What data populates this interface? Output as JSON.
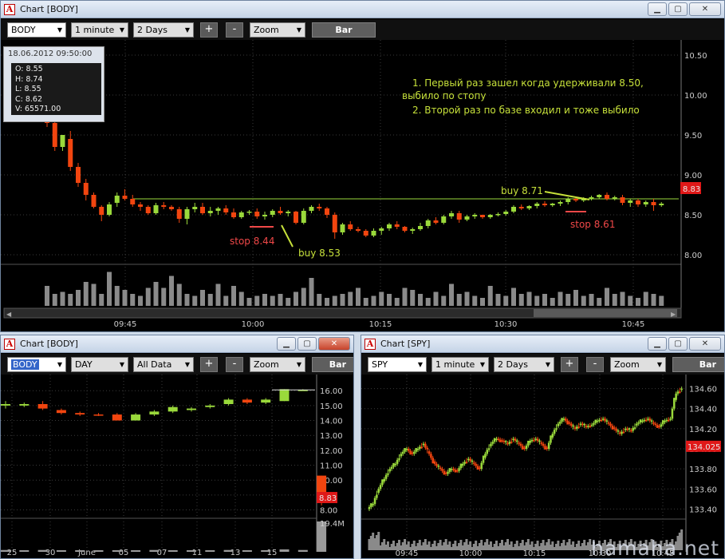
{
  "colors": {
    "up": "#9ad93b",
    "down": "#f2450f",
    "grid": "#2e2e2e",
    "note": "#c6e03a",
    "stop": "#f04848",
    "badge": "#e01818"
  },
  "main": {
    "title": "Chart [BODY]",
    "toolbar": {
      "symbol": "BODY",
      "interval": "1 minute",
      "range": "2 Days",
      "zoom": "Zoom",
      "plus": "+",
      "minus": "-",
      "bar": "Bar"
    },
    "info": {
      "datetime": "18.06.2012 09:50:00",
      "o": "O: 8.55",
      "h": "H: 8.74",
      "l": "L: 8.55",
      "c": "C: 8.62",
      "v": "V: 65571.00"
    },
    "notes": {
      "line1": "1. Первый раз зашел когда удерживали 8.50,",
      "line2": "выбило по стопу",
      "line3": "2. Второй раз по базе входил и тоже выбило"
    },
    "annotations": {
      "buy1": "buy 8.53",
      "buy2": "buy 8.71",
      "stop1": "stop 8.44",
      "stop2": "stop 8.61"
    },
    "current_price": "8.83",
    "price_ticks": [
      "10.50",
      "10.00",
      "9.50",
      "9.00",
      "8.50",
      "8.00"
    ],
    "time_ticks": [
      "09:45",
      "10:00",
      "10:15",
      "10:30",
      "10:45"
    ]
  },
  "daily": {
    "title": "Chart [BODY]",
    "toolbar": {
      "symbol": "BODY",
      "interval": "DAY",
      "range": "All Data",
      "zoom": "Zoom",
      "plus": "+",
      "minus": "-",
      "bar": "Bar"
    },
    "current_price": "8.83",
    "volume_label": "19.4M",
    "price_ticks": [
      "16.00",
      "15.00",
      "14.00",
      "13.00",
      "12.00",
      "11.00",
      "10.00",
      "9.00",
      "8.00"
    ],
    "date_ticks": [
      "25",
      "30",
      "June",
      "05",
      "07",
      "11",
      "13",
      "15"
    ]
  },
  "spy": {
    "title": "Chart [SPY]",
    "toolbar": {
      "symbol": "SPY",
      "interval": "1 minute",
      "range": "2 Days",
      "zoom": "Zoom",
      "plus": "+",
      "minus": "-",
      "bar": "Bar"
    },
    "current_price": "134.025",
    "price_ticks": [
      "134.60",
      "134.40",
      "134.20",
      "134.00",
      "133.80",
      "133.60",
      "133.40"
    ],
    "time_ticks": [
      "09:45",
      "10:00",
      "10:15",
      "10:30",
      "10:45"
    ]
  },
  "watermark": "hamaha.net",
  "chart_data": [
    {
      "type": "candlestick",
      "title": "BODY 1 minute",
      "ylim": [
        7.9,
        10.6
      ],
      "ohlc": [
        [
          9.95,
          10.05,
          9.6,
          9.65
        ],
        [
          9.65,
          9.7,
          9.3,
          9.35
        ],
        [
          9.35,
          9.5,
          9.3,
          9.5
        ],
        [
          9.45,
          9.55,
          9.05,
          9.1
        ],
        [
          9.1,
          9.15,
          8.85,
          8.9
        ],
        [
          8.9,
          8.95,
          8.68,
          8.75
        ],
        [
          8.75,
          8.78,
          8.58,
          8.6
        ],
        [
          8.6,
          8.62,
          8.42,
          8.5
        ],
        [
          8.5,
          8.66,
          8.48,
          8.63
        ],
        [
          8.65,
          8.78,
          8.6,
          8.74
        ],
        [
          8.74,
          8.82,
          8.68,
          8.7
        ],
        [
          8.7,
          8.75,
          8.6,
          8.63
        ],
        [
          8.63,
          8.66,
          8.55,
          8.6
        ],
        [
          8.6,
          8.62,
          8.5,
          8.52
        ],
        [
          8.52,
          8.65,
          8.5,
          8.62
        ],
        [
          8.62,
          8.66,
          8.57,
          8.6
        ],
        [
          8.6,
          8.62,
          8.55,
          8.57
        ],
        [
          8.57,
          8.6,
          8.4,
          8.45
        ],
        [
          8.45,
          8.6,
          8.38,
          8.57
        ],
        [
          8.57,
          8.65,
          8.53,
          8.6
        ],
        [
          8.6,
          8.65,
          8.5,
          8.52
        ],
        [
          8.52,
          8.6,
          8.48,
          8.55
        ],
        [
          8.55,
          8.6,
          8.5,
          8.58
        ],
        [
          8.58,
          8.62,
          8.5,
          8.53
        ],
        [
          8.53,
          8.58,
          8.45,
          8.47
        ],
        [
          8.47,
          8.55,
          8.45,
          8.53
        ],
        [
          8.53,
          8.56,
          8.5,
          8.54
        ],
        [
          8.54,
          8.58,
          8.45,
          8.48
        ],
        [
          8.48,
          8.54,
          8.44,
          8.5
        ],
        [
          8.5,
          8.57,
          8.47,
          8.55
        ],
        [
          8.55,
          8.6,
          8.5,
          8.52
        ],
        [
          8.52,
          8.56,
          8.48,
          8.54
        ],
        [
          8.54,
          8.55,
          8.38,
          8.4
        ],
        [
          8.4,
          8.58,
          8.38,
          8.55
        ],
        [
          8.55,
          8.62,
          8.52,
          8.6
        ],
        [
          8.6,
          8.64,
          8.55,
          8.58
        ],
        [
          8.58,
          8.6,
          8.46,
          8.5
        ],
        [
          8.5,
          8.53,
          8.2,
          8.28
        ],
        [
          8.28,
          8.4,
          8.25,
          8.38
        ],
        [
          8.38,
          8.42,
          8.3,
          8.32
        ],
        [
          8.32,
          8.35,
          8.28,
          8.3
        ],
        [
          8.3,
          8.32,
          8.22,
          8.24
        ],
        [
          8.24,
          8.33,
          8.22,
          8.3
        ],
        [
          8.3,
          8.35,
          8.25,
          8.33
        ],
        [
          8.33,
          8.4,
          8.3,
          8.38
        ],
        [
          8.38,
          8.42,
          8.32,
          8.35
        ],
        [
          8.35,
          8.36,
          8.28,
          8.3
        ],
        [
          8.3,
          8.34,
          8.26,
          8.32
        ],
        [
          8.32,
          8.4,
          8.3,
          8.36
        ],
        [
          8.36,
          8.45,
          8.33,
          8.43
        ],
        [
          8.43,
          8.47,
          8.38,
          8.4
        ],
        [
          8.4,
          8.5,
          8.38,
          8.48
        ],
        [
          8.48,
          8.55,
          8.45,
          8.52
        ],
        [
          8.52,
          8.55,
          8.4,
          8.44
        ],
        [
          8.44,
          8.5,
          8.42,
          8.48
        ],
        [
          8.48,
          8.52,
          8.45,
          8.5
        ],
        [
          8.5,
          8.5,
          8.45,
          8.47
        ],
        [
          8.47,
          8.51,
          8.45,
          8.5
        ],
        [
          8.5,
          8.53,
          8.48,
          8.51
        ],
        [
          8.51,
          8.56,
          8.49,
          8.54
        ],
        [
          8.54,
          8.62,
          8.52,
          8.6
        ],
        [
          8.6,
          8.63,
          8.56,
          8.58
        ],
        [
          8.58,
          8.62,
          8.56,
          8.61
        ],
        [
          8.61,
          8.66,
          8.58,
          8.64
        ],
        [
          8.64,
          8.67,
          8.6,
          8.62
        ],
        [
          8.62,
          8.65,
          8.6,
          8.64
        ],
        [
          8.64,
          8.68,
          8.61,
          8.66
        ],
        [
          8.66,
          8.72,
          8.63,
          8.7
        ],
        [
          8.7,
          8.73,
          8.66,
          8.68
        ],
        [
          8.68,
          8.72,
          8.66,
          8.71
        ],
        [
          8.71,
          8.74,
          8.68,
          8.72
        ],
        [
          8.72,
          8.76,
          8.7,
          8.75
        ],
        [
          8.75,
          8.78,
          8.68,
          8.7
        ],
        [
          8.7,
          8.74,
          8.68,
          8.72
        ],
        [
          8.72,
          8.75,
          8.62,
          8.65
        ],
        [
          8.65,
          8.7,
          8.6,
          8.68
        ],
        [
          8.68,
          8.7,
          8.6,
          8.63
        ],
        [
          8.63,
          8.68,
          8.6,
          8.66
        ],
        [
          8.66,
          8.7,
          8.55,
          8.62
        ],
        [
          8.62,
          8.66,
          8.6,
          8.64
        ]
      ],
      "volume_relative": [
        0.5,
        0.3,
        0.35,
        0.3,
        0.4,
        0.6,
        0.55,
        0.3,
        0.85,
        0.5,
        0.4,
        0.3,
        0.25,
        0.45,
        0.6,
        0.45,
        0.75,
        0.55,
        0.3,
        0.25,
        0.4,
        0.3,
        0.55,
        0.25,
        0.5,
        0.35,
        0.2,
        0.25,
        0.3,
        0.25,
        0.3,
        0.2,
        0.35,
        0.45,
        0.7,
        0.3,
        0.2,
        0.25,
        0.3,
        0.35,
        0.45,
        0.2,
        0.25,
        0.35,
        0.3,
        0.2,
        0.45,
        0.4,
        0.3,
        0.2,
        0.35,
        0.25,
        0.55,
        0.3,
        0.35,
        0.25,
        0.2,
        0.5,
        0.3,
        0.25,
        0.45,
        0.3,
        0.35,
        0.25,
        0.3,
        0.2,
        0.35,
        0.3,
        0.4,
        0.25,
        0.3,
        0.2,
        0.45,
        0.3,
        0.35,
        0.25,
        0.2,
        0.35,
        0.3,
        0.25
      ]
    },
    {
      "type": "candlestick",
      "title": "BODY DAY",
      "ylim": [
        7.6,
        16.6
      ],
      "ohlc": [
        [
          15.0,
          15.3,
          14.8,
          15.1
        ],
        [
          15.0,
          15.2,
          14.9,
          15.1
        ],
        [
          15.1,
          15.3,
          14.7,
          14.8
        ],
        [
          14.7,
          14.8,
          14.4,
          14.5
        ],
        [
          14.5,
          14.6,
          14.3,
          14.4
        ],
        [
          14.4,
          14.5,
          14.3,
          14.35
        ],
        [
          14.4,
          14.5,
          14.0,
          14.0
        ],
        [
          14.0,
          14.5,
          14.0,
          14.4
        ],
        [
          14.4,
          14.7,
          14.3,
          14.6
        ],
        [
          14.6,
          15.0,
          14.5,
          14.9
        ],
        [
          14.7,
          14.9,
          14.6,
          14.8
        ],
        [
          14.9,
          15.1,
          14.8,
          15.0
        ],
        [
          15.1,
          15.5,
          15.0,
          15.4
        ],
        [
          15.4,
          15.5,
          15.1,
          15.2
        ],
        [
          15.2,
          15.5,
          15.1,
          15.4
        ],
        [
          15.3,
          16.1,
          15.3,
          16.1
        ],
        [
          16.05,
          16.1,
          16.0,
          16.05
        ],
        [
          10.3,
          10.3,
          8.3,
          8.8
        ]
      ],
      "volume_relative": [
        0.06,
        0.05,
        0.06,
        0.04,
        0.05,
        0.04,
        0.04,
        0.05,
        0.06,
        0.05,
        0.04,
        0.05,
        0.06,
        0.05,
        0.04,
        0.08,
        0.06,
        1.0
      ]
    },
    {
      "type": "candlestick",
      "title": "SPY 1 minute",
      "ylim": [
        133.3,
        134.7
      ],
      "close": [
        133.45,
        133.6,
        133.7,
        133.8,
        133.85,
        133.95,
        134.0,
        133.95,
        134.0,
        134.05,
        133.95,
        133.85,
        133.8,
        133.75,
        133.8,
        133.78,
        133.85,
        133.9,
        133.85,
        133.8,
        133.95,
        134.05,
        134.1,
        134.08,
        134.05,
        134.1,
        134.05,
        134.0,
        134.08,
        134.1,
        134.05,
        134.0,
        134.15,
        134.25,
        134.3,
        134.25,
        134.2,
        134.25,
        134.22,
        134.24,
        134.28,
        134.3,
        134.25,
        134.2,
        134.15,
        134.2,
        134.18,
        134.25,
        134.28,
        134.3,
        134.25,
        134.22,
        134.28,
        134.3,
        134.55,
        134.6
      ]
    }
  ]
}
